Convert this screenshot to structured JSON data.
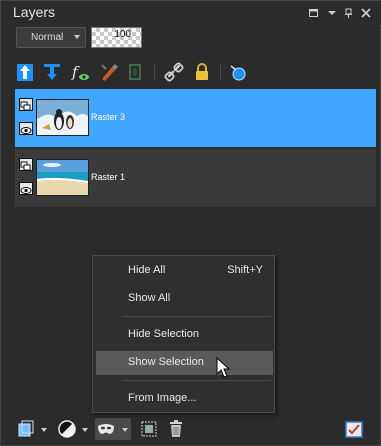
{
  "panel": {
    "title": "Layers",
    "window_buttons": [
      "restore-icon",
      "dropdown-icon",
      "pin-icon",
      "close-icon"
    ]
  },
  "blend": {
    "mode": "Normal",
    "opacity": "100"
  },
  "toolbar": {
    "icons": [
      "move-up-icon",
      "move-down-icon",
      "effects-icon",
      "edit-effect-icon",
      "mask-icon",
      "link-icon",
      "lock-icon",
      "visibility-globe-icon"
    ]
  },
  "layers": [
    {
      "name": "Raster 3",
      "selected": true,
      "thumb": "penguins"
    },
    {
      "name": "Raster 1",
      "selected": false,
      "thumb": "beach"
    }
  ],
  "menu": {
    "items": [
      {
        "label": "Hide All",
        "shortcut": "Shift+Y"
      },
      {
        "label": "Show All",
        "shortcut": ""
      },
      {
        "label": "Hide Selection",
        "shortcut": ""
      },
      {
        "label": "Show Selection",
        "shortcut": "",
        "highlighted": true
      },
      {
        "label": "From Image...",
        "shortcut": ""
      }
    ]
  },
  "bottom": {
    "icons": [
      "new-layer-icon",
      "adjustment-layer-icon",
      "mask-layer-icon",
      "group-icon",
      "delete-icon",
      "properties-icon"
    ]
  },
  "colors": {
    "selection": "#41a6ff",
    "panel": "#2b2b2b",
    "menu_highlight": "#5a5a5a"
  }
}
